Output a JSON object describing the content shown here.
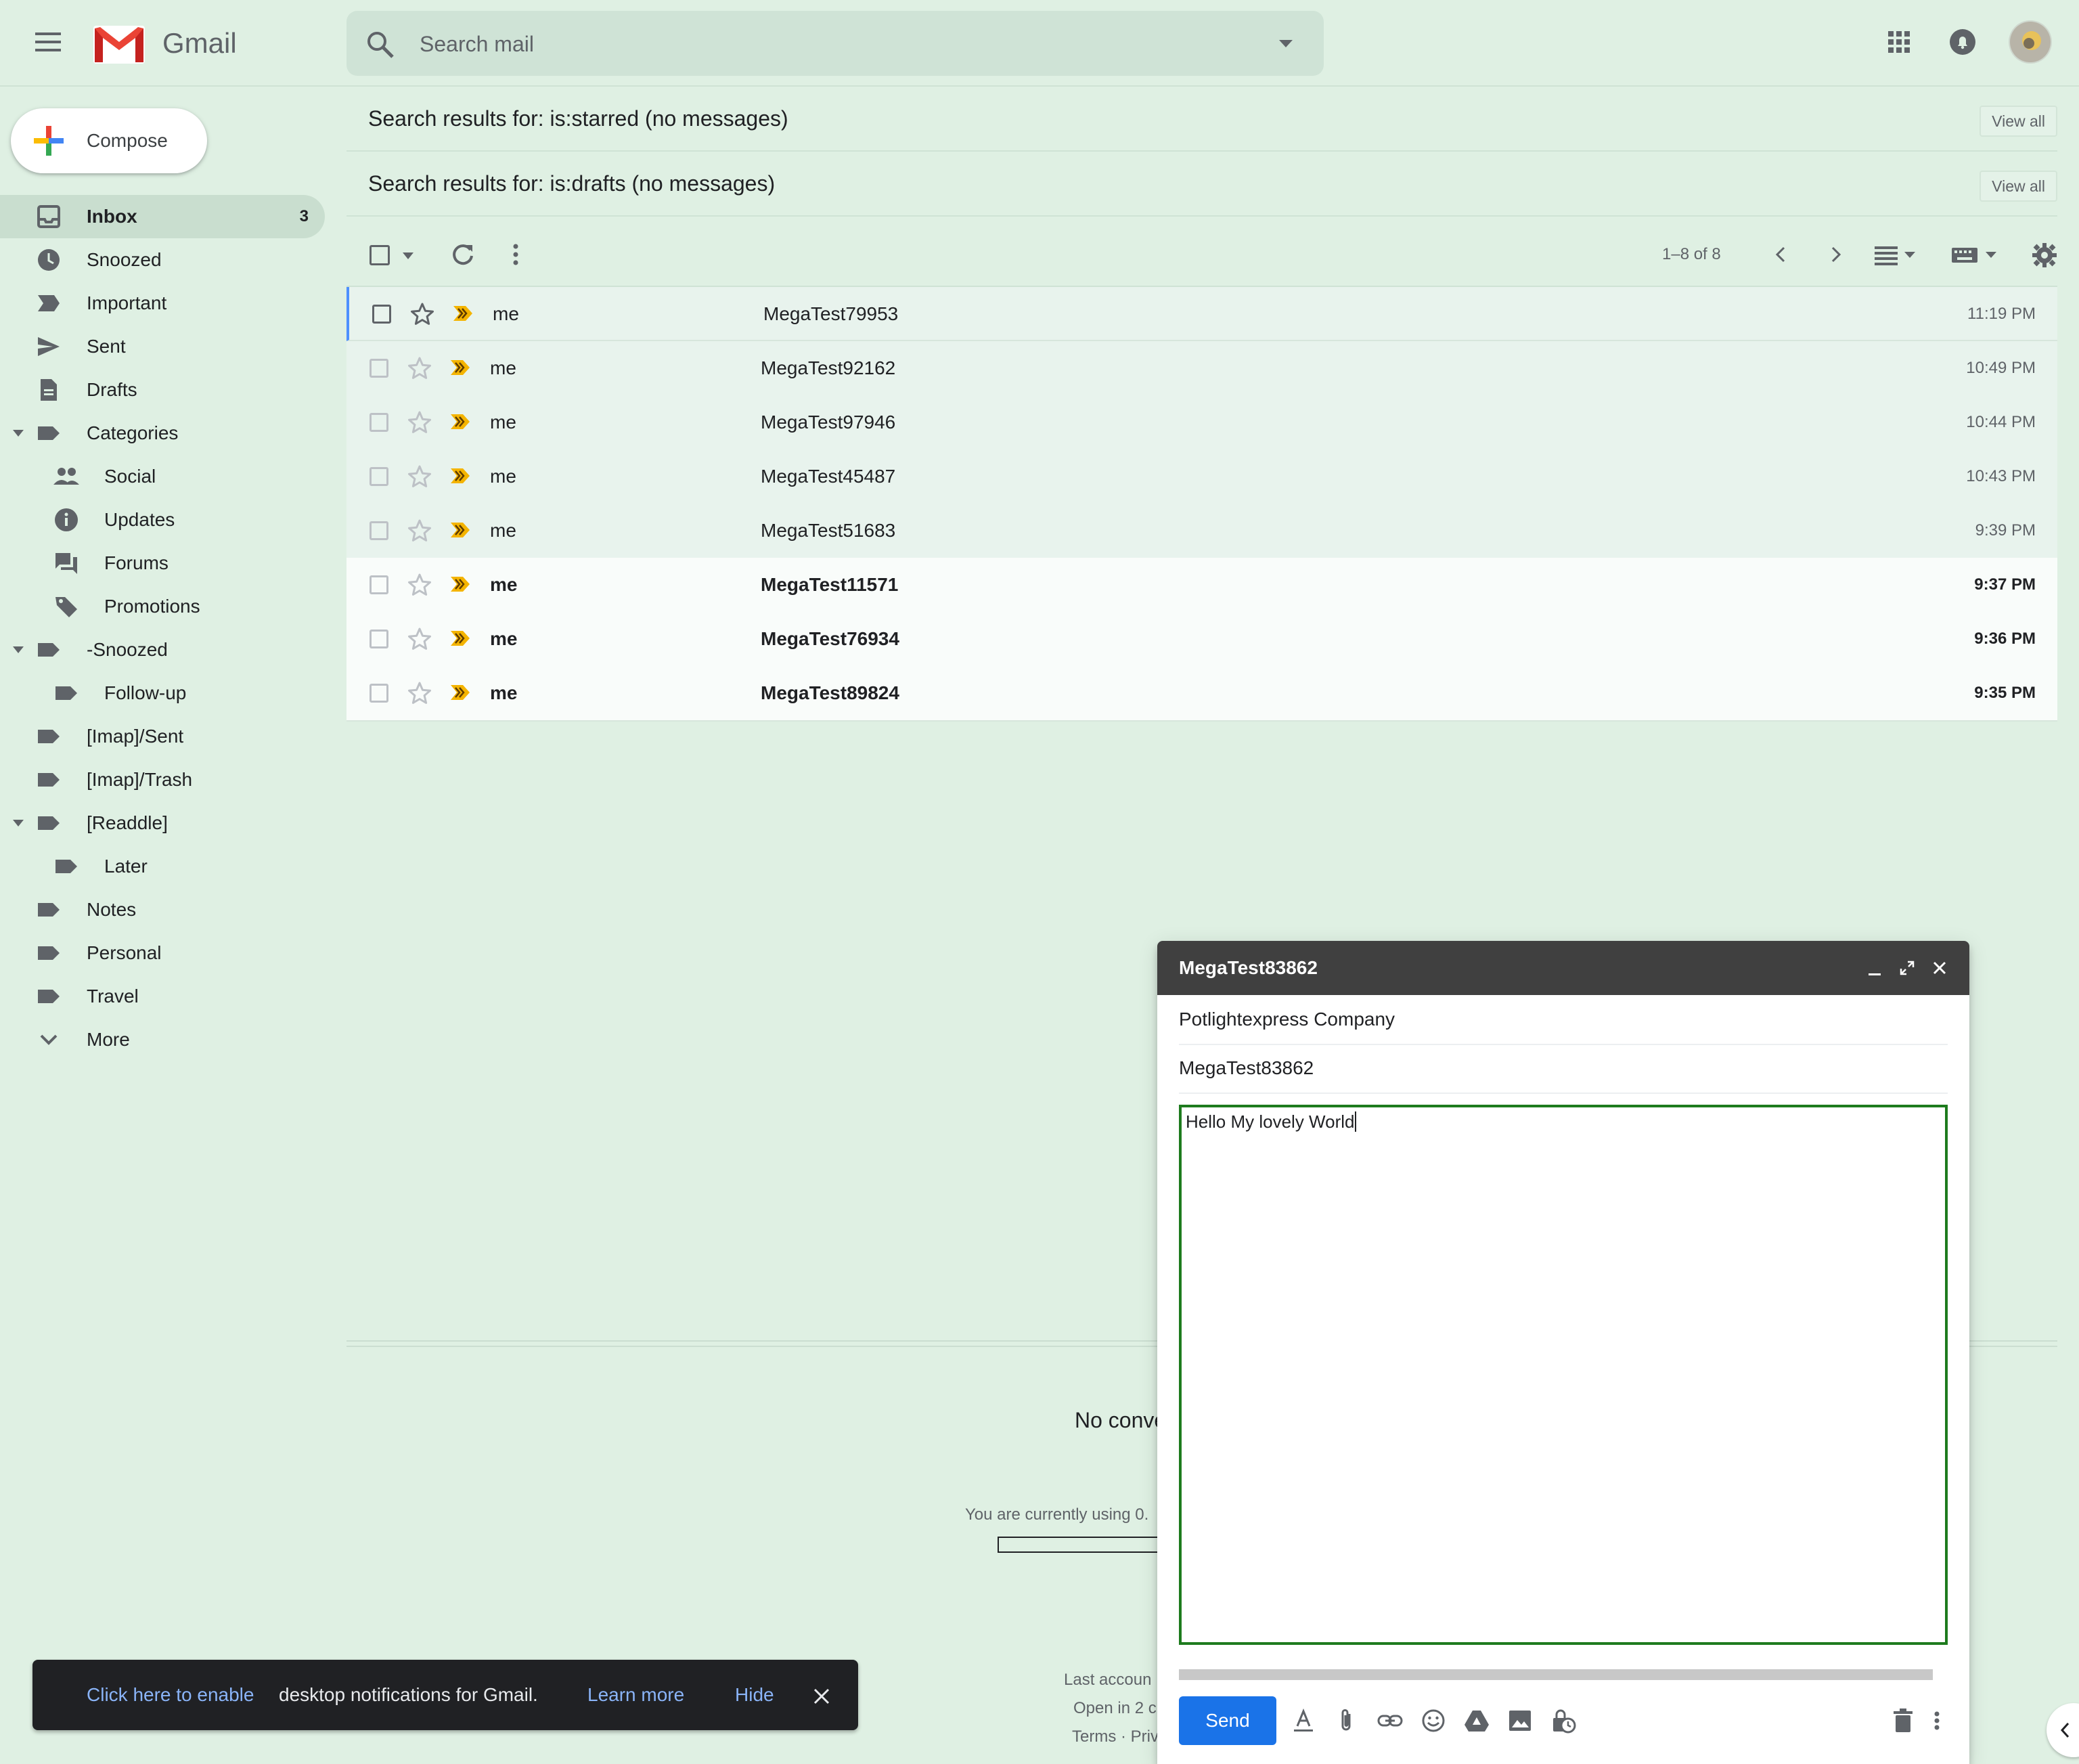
{
  "app": {
    "name": "Gmail"
  },
  "search": {
    "placeholder": "Search mail"
  },
  "compose_label": "Compose",
  "sidebar": {
    "items": [
      {
        "label": "Inbox",
        "count": "3"
      },
      {
        "label": "Snoozed"
      },
      {
        "label": "Important"
      },
      {
        "label": "Sent"
      },
      {
        "label": "Drafts"
      },
      {
        "label": "Categories"
      },
      {
        "label": "Social"
      },
      {
        "label": "Updates"
      },
      {
        "label": "Forums"
      },
      {
        "label": "Promotions"
      },
      {
        "label": "-Snoozed"
      },
      {
        "label": "Follow-up"
      },
      {
        "label": "[Imap]/Sent"
      },
      {
        "label": "[Imap]/Trash"
      },
      {
        "label": "[Readdle]"
      },
      {
        "label": "Later"
      },
      {
        "label": "Notes"
      },
      {
        "label": "Personal"
      },
      {
        "label": "Travel"
      },
      {
        "label": "More"
      }
    ]
  },
  "search_results": [
    {
      "text": "Search results for: is:starred (no messages)",
      "action": "View all"
    },
    {
      "text": "Search results for: is:drafts (no messages)",
      "action": "View all"
    }
  ],
  "toolbar": {
    "pagination": "1–8 of 8"
  },
  "emails": [
    {
      "sender": "me",
      "subject": "MegaTest79953",
      "time": "11:19 PM",
      "unread": false
    },
    {
      "sender": "me",
      "subject": "MegaTest92162",
      "time": "10:49 PM",
      "unread": false
    },
    {
      "sender": "me",
      "subject": "MegaTest97946",
      "time": "10:44 PM",
      "unread": false
    },
    {
      "sender": "me",
      "subject": "MegaTest45487",
      "time": "10:43 PM",
      "unread": false
    },
    {
      "sender": "me",
      "subject": "MegaTest51683",
      "time": "9:39 PM",
      "unread": false
    },
    {
      "sender": "me",
      "subject": "MegaTest11571",
      "time": "9:37 PM",
      "unread": true
    },
    {
      "sender": "me",
      "subject": "MegaTest76934",
      "time": "9:36 PM",
      "unread": true
    },
    {
      "sender": "me",
      "subject": "MegaTest89824",
      "time": "9:35 PM",
      "unread": true
    }
  ],
  "footer": {
    "no_conversations": "No conve",
    "storage": "You are currently using 0.",
    "last_account": "Last accoun",
    "open_in": "Open in 2 c",
    "terms": "Terms · Priv"
  },
  "compose_window": {
    "title": "MegaTest83862",
    "to": "Potlightexpress Company",
    "subject": "MegaTest83862",
    "body": "Hello My lovely World",
    "send_label": "Send"
  },
  "notification": {
    "enable_link": "Click here to enable",
    "message": "desktop notifications for Gmail.",
    "learn_more": "Learn more",
    "hide": "Hide"
  },
  "colors": {
    "background": "#dff0e3",
    "accent_blue": "#1a73e8",
    "important_marker": "#f4b400",
    "compose_header": "#404040",
    "focus_border": "#1e7b1e"
  }
}
